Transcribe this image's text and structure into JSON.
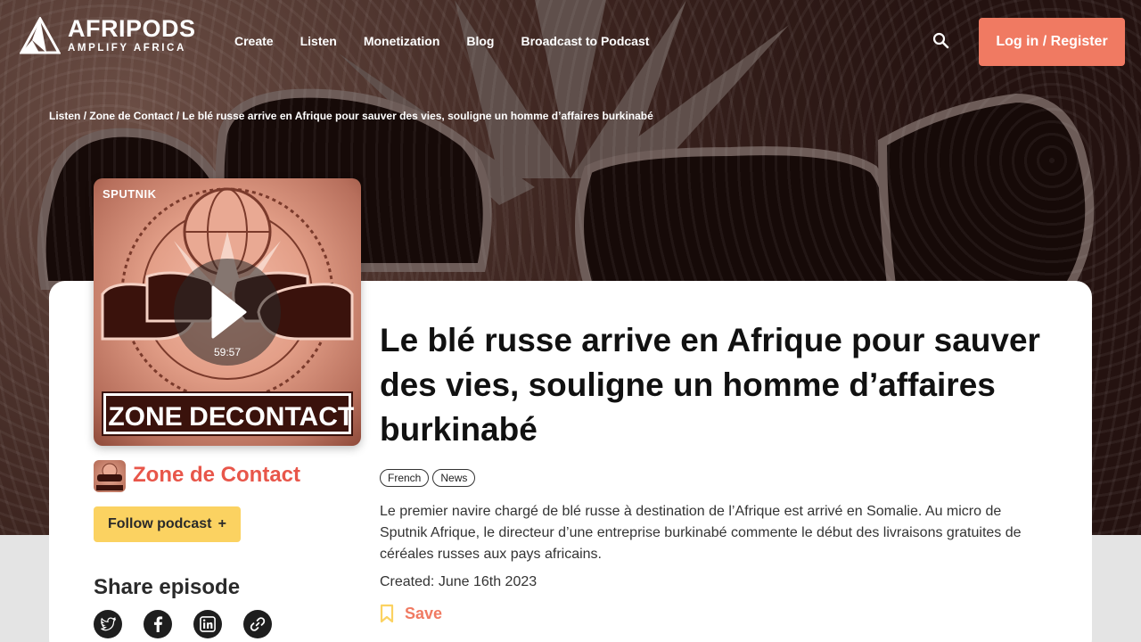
{
  "header": {
    "logo": {
      "name": "AFRIPODS",
      "tagline": "AMPLIFY AFRICA"
    },
    "nav": [
      "Create",
      "Listen",
      "Monetization",
      "Blog",
      "Broadcast to Podcast"
    ],
    "search_icon": "search-icon",
    "login_label": "Log in / Register"
  },
  "breadcrumb": {
    "items": [
      "Listen",
      "Zone de Contact",
      "Le blé russe arrive en Afrique pour sauver des vies, souligne un homme d’affaires burkinabé"
    ],
    "separator": "/"
  },
  "cover": {
    "brand": "SPUTNIK",
    "show_title": [
      "ZONE",
      "DE",
      "CONTACT"
    ],
    "duration": "59:57"
  },
  "podcast": {
    "name": "Zone de Contact",
    "follow_label": "Follow podcast",
    "follow_icon": "+"
  },
  "share": {
    "title": "Share episode",
    "icons": [
      "twitter-icon",
      "facebook-icon",
      "linkedin-icon",
      "link-icon"
    ]
  },
  "episode": {
    "title": "Le blé russe arrive en Afrique pour sauver des vies, souligne un homme d’affaires burkinabé",
    "tags": [
      "French",
      "News"
    ],
    "description": "Le premier navire chargé de blé russe à destination de l’Afrique est arrivé en Somalie. Au micro de Sputnik Afrique, le directeur d’une entreprise burkinabé commente le début des livraisons gratuites de céréales russes aux pays africains.",
    "created": "Created: June 16th 2023",
    "save_label": "Save"
  },
  "colors": {
    "accent": "#f07a62",
    "podcast_name": "#e8564a",
    "follow_bg": "#fbd261",
    "save_icon": "#fbd261"
  }
}
